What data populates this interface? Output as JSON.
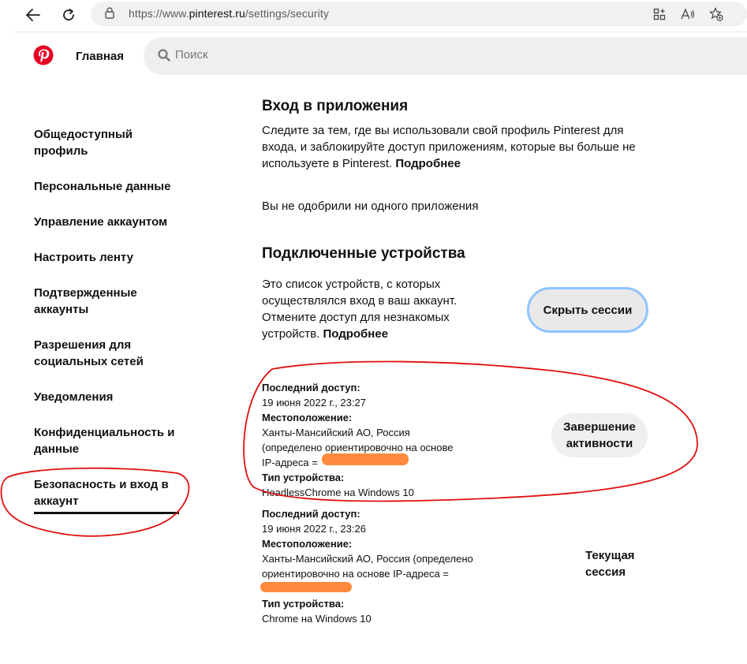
{
  "browser": {
    "url_prefix": "https://www.",
    "url_domain": "pinterest.ru",
    "url_path": "/settings/security",
    "icons": [
      "back-arrow-icon",
      "refresh-icon",
      "lock-icon",
      "apps-icon",
      "read-aloud-icon",
      "favorites-add-icon"
    ]
  },
  "header": {
    "home_label": "Главная",
    "search_placeholder": "Поиск",
    "brand_color": "#e60023"
  },
  "sidebar": {
    "items": [
      {
        "label": "Общедоступный профиль"
      },
      {
        "label": "Персональные данные"
      },
      {
        "label": "Управление аккаунтом"
      },
      {
        "label": "Настроить ленту"
      },
      {
        "label": "Подтвержденные аккаунты"
      },
      {
        "label": "Разрешения для социальных сетей"
      },
      {
        "label": "Уведомления"
      },
      {
        "label": "Конфиденциальность и данные"
      },
      {
        "label": "Безопасность и вход в аккаунт",
        "active": true
      }
    ]
  },
  "apps_section": {
    "title": "Вход в приложения",
    "description": "Следите за тем, где вы использовали свой профиль Pinterest для входа, и заблокируйте доступ приложениям, которые вы больше не используете в Pinterest.",
    "more_link": "Подробнее",
    "empty_text": "Вы не одобрили ни одного приложения"
  },
  "devices_section": {
    "title": "Подключенные устройства",
    "description": "Это список устройств, с которых осуществлялся вход в ваш аккаунт. Отмените доступ для незнакомых устройств.",
    "more_link": "Подробнее",
    "hide_sessions_button": "Скрыть сессии",
    "sessions": [
      {
        "last_access_label": "Последний доступ:",
        "last_access_value": "19 июня 2022 г., 23:27",
        "location_label": "Местоположение:",
        "location_line1": "Ханты-Мансийский АО, Россия",
        "location_line2": "(определено ориентировочно на основе",
        "location_line3": "IP-адреса =",
        "device_label": "Тип устройства:",
        "device_value": "HeadlessChrome на Windows 10",
        "action_button": "Завершение активности"
      },
      {
        "last_access_label": "Последний доступ:",
        "last_access_value": "19 июня 2022 г., 23:26",
        "location_label": "Местоположение:",
        "location_line1": "Ханты-Мансийский АО, Россия (определено",
        "location_line2": "ориентировочно на основе IP-адреса =",
        "device_label": "Тип устройства:",
        "device_value": "Chrome на Windows 10",
        "status_label": "Текущая сессия"
      }
    ]
  },
  "annotation_colors": {
    "circle": "#e01010",
    "redaction": "#ff8a3d",
    "focus_ring": "#8fc3ff"
  }
}
